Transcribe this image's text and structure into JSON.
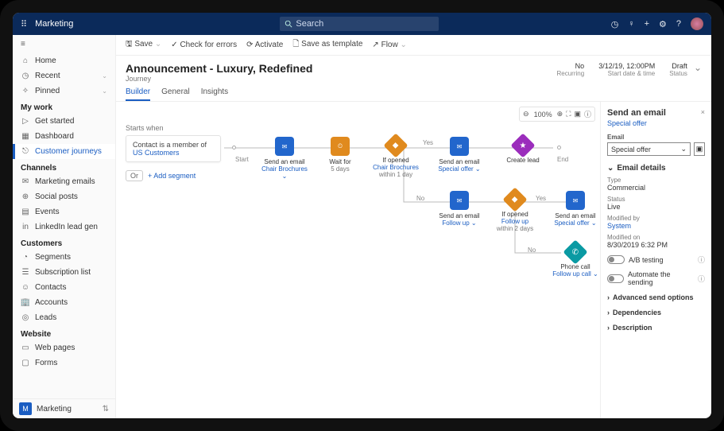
{
  "topbar": {
    "app": "Marketing",
    "search_placeholder": "Search"
  },
  "toolbar": {
    "save": "Save",
    "check": "Check for errors",
    "activate": "Activate",
    "template": "Save as template",
    "flow": "Flow"
  },
  "header": {
    "title": "Announcement - Luxury, Redefined",
    "subtitle": "Journey",
    "meta": [
      {
        "value": "No",
        "label": "Recurring"
      },
      {
        "value": "3/12/19, 12:00PM",
        "label": "Start date & time"
      },
      {
        "value": "Draft",
        "label": "Status"
      }
    ]
  },
  "tabs": [
    "Builder",
    "General",
    "Insights"
  ],
  "canvas": {
    "starts_when": "Starts when",
    "segment_text": "Contact is a member of",
    "segment_link": "US Customers",
    "or_label": "Or",
    "add_segment": "+ Add segment",
    "zoom": "100%",
    "start_label": "Start",
    "end_label": "End",
    "yes": "Yes",
    "no": "No",
    "nodes": {
      "email1": {
        "title": "Send an email",
        "link": "Chair Brochures"
      },
      "wait": {
        "title": "Wait for",
        "sub": "5 days"
      },
      "if1": {
        "title": "If opened",
        "link": "Chair Brochures",
        "sub": "within 1 day"
      },
      "email2": {
        "title": "Send an email",
        "link": "Special offer"
      },
      "lead": {
        "title": "Create lead"
      },
      "email3": {
        "title": "Send an email",
        "link": "Follow up"
      },
      "if2": {
        "title": "If opened",
        "link": "Follow up",
        "sub": "within 2 days"
      },
      "email4": {
        "title": "Send an email",
        "link": "Special offer"
      },
      "phone": {
        "title": "Phone call",
        "link": "Follow up call"
      }
    }
  },
  "sidebar": {
    "items": [
      {
        "icon": "home",
        "label": "Home"
      },
      {
        "icon": "clock",
        "label": "Recent",
        "chev": true
      },
      {
        "icon": "pin",
        "label": "Pinned",
        "chev": true
      }
    ],
    "sections": [
      {
        "head": "My work",
        "items": [
          {
            "icon": "rocket",
            "label": "Get started"
          },
          {
            "icon": "grid",
            "label": "Dashboard"
          },
          {
            "icon": "journey",
            "label": "Customer journeys",
            "active": true
          }
        ]
      },
      {
        "head": "Channels",
        "items": [
          {
            "icon": "mail",
            "label": "Marketing emails"
          },
          {
            "icon": "share",
            "label": "Social posts"
          },
          {
            "icon": "cal",
            "label": "Events"
          },
          {
            "icon": "linkedin",
            "label": "LinkedIn lead gen"
          }
        ]
      },
      {
        "head": "Customers",
        "items": [
          {
            "icon": "seg",
            "label": "Segments"
          },
          {
            "icon": "list",
            "label": "Subscription list"
          },
          {
            "icon": "person",
            "label": "Contacts"
          },
          {
            "icon": "building",
            "label": "Accounts"
          },
          {
            "icon": "target",
            "label": "Leads"
          }
        ]
      },
      {
        "head": "Website",
        "items": [
          {
            "icon": "page",
            "label": "Web pages"
          },
          {
            "icon": "form",
            "label": "Forms"
          }
        ]
      }
    ],
    "footer": {
      "badge": "M",
      "label": "Marketing"
    }
  },
  "details": {
    "title": "Send an email",
    "link": "Special offer",
    "email_label": "Email",
    "email_value": "Special offer",
    "section_details": "Email details",
    "kv": [
      {
        "k": "Type",
        "v": "Commercial"
      },
      {
        "k": "Status",
        "v": "Live"
      },
      {
        "k": "Modified by",
        "v": "System",
        "link": true
      },
      {
        "k": "Modified on",
        "v": "8/30/2019  6:32 PM"
      }
    ],
    "ab": "A/B testing",
    "automate": "Automate the sending",
    "adv": "Advanced send options",
    "deps": "Dependencies",
    "desc": "Description"
  }
}
